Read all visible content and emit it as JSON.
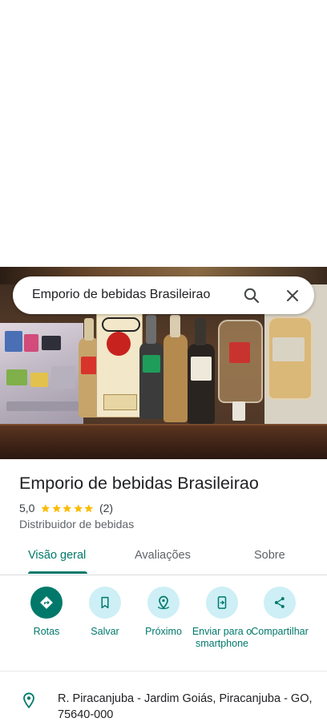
{
  "search": {
    "query": "Emporio de bebidas Brasileirao"
  },
  "place": {
    "title": "Emporio de bebidas Brasileirao",
    "rating": "5,0",
    "stars": 5,
    "review_count": "(2)",
    "category": "Distribuidor de bebidas"
  },
  "tabs": [
    {
      "label": "Visão geral",
      "selected": true
    },
    {
      "label": "Avaliações",
      "selected": false
    },
    {
      "label": "Sobre",
      "selected": false
    }
  ],
  "actions": [
    {
      "label": "Rotas",
      "icon": "directions-icon"
    },
    {
      "label": "Salvar",
      "icon": "bookmark-icon"
    },
    {
      "label": "Próximo",
      "icon": "nearby-icon"
    },
    {
      "label": "Enviar para o smartphone",
      "icon": "send-to-phone-icon"
    },
    {
      "label": "Compartilhar",
      "icon": "share-icon"
    }
  ],
  "address": {
    "text": "R. Piracanjuba - Jardim Goiás, Piracanjuba - GO, 75640-000",
    "icon": "location-pin-icon"
  },
  "colors": {
    "accent": "#00796b",
    "action_bg": "#cdeff5",
    "star": "#fbbc04"
  }
}
